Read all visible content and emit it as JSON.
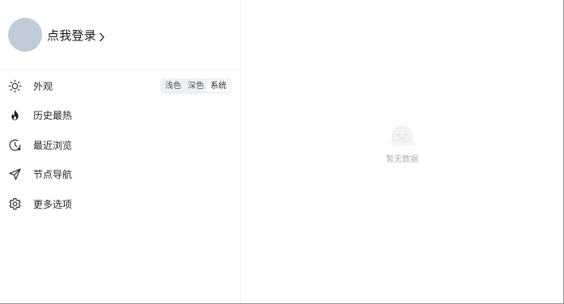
{
  "profile": {
    "login_label": "点我登录",
    "chevron_icon": "chevron-right-icon",
    "avatar_color": "#bfcbd6"
  },
  "menu": {
    "items": [
      {
        "label": "外观",
        "icon": "sun-icon"
      },
      {
        "label": "历史最热",
        "icon": "flame-icon"
      },
      {
        "label": "最近浏览",
        "icon": "clock-history-icon"
      },
      {
        "label": "节点导航",
        "icon": "navigation-arrow-icon"
      },
      {
        "label": "更多选项",
        "icon": "gear-icon"
      }
    ],
    "theme_options": [
      "浅色",
      "深色",
      "系统"
    ],
    "theme_selected": "系统"
  },
  "main": {
    "empty_icon": "empty-box-icon",
    "empty_text": "暂无数据"
  }
}
